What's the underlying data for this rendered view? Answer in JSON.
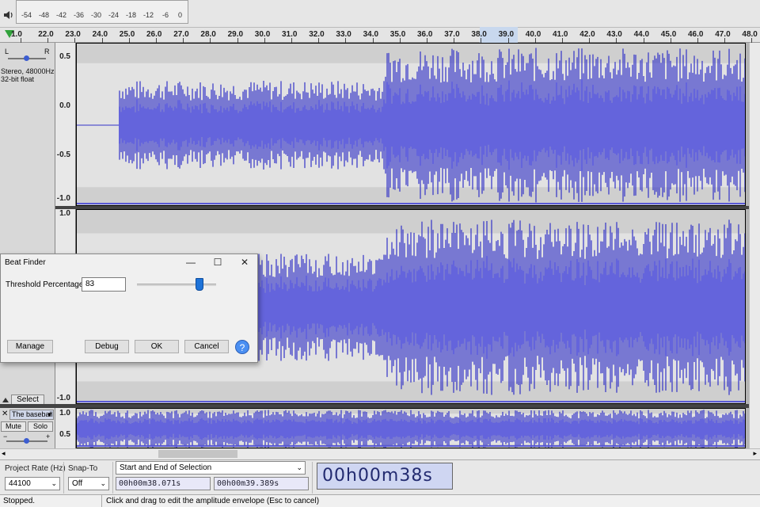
{
  "meter": {
    "ticks": [
      "-54",
      "-48",
      "-42",
      "-36",
      "-30",
      "-24",
      "-18",
      "-12",
      "-6",
      "0"
    ]
  },
  "ruler": {
    "labels": [
      "1.0",
      "22.0",
      "23.0",
      "24.0",
      "25.0",
      "26.0",
      "27.0",
      "28.0",
      "29.0",
      "30.0",
      "31.0",
      "32.0",
      "33.0",
      "34.0",
      "35.0",
      "36.0",
      "37.0",
      "38.0",
      "39.0",
      "40.0",
      "41.0",
      "42.0",
      "43.0",
      "44.0",
      "45.0",
      "46.0",
      "47.0",
      "48.0"
    ]
  },
  "track1": {
    "pan_left": "L",
    "pan_right": "R",
    "info_line1": "Stereo, 48000Hz",
    "info_line2": "32-bit float",
    "scale": [
      "0.5",
      "0.0",
      "-0.5",
      "-1.0"
    ],
    "scale_lower": [
      "1.0",
      "-1.0"
    ],
    "select_label": "Select"
  },
  "track2": {
    "name": "The baseball",
    "mute_label": "Mute",
    "solo_label": "Solo",
    "scale": [
      "1.0",
      "0.5"
    ]
  },
  "dialog": {
    "title": "Beat Finder",
    "threshold_label": "Threshold Percentage:",
    "threshold_value": "83",
    "manage_label": "Manage",
    "debug_label": "Debug",
    "ok_label": "OK",
    "cancel_label": "Cancel",
    "help_icon": "?",
    "slider_percent": 83
  },
  "bottom": {
    "project_rate_label": "Project Rate (Hz)",
    "project_rate_value": "44100",
    "snap_to_label": "Snap-To",
    "snap_to_value": "Off",
    "selection_mode": "Start and End of Selection",
    "sel_start": "00h00m38.071s",
    "sel_end": "00h00m39.389s",
    "audio_position": "00h00m38s"
  },
  "status": {
    "state": "Stopped.",
    "hint": "Click and drag to edit the amplitude envelope (Esc to cancel)"
  },
  "colors": {
    "wave_dark": "#3232c8",
    "wave_light": "#6464dc",
    "wave_bg": "#cfcfcf",
    "clip_bg": "#b4b4b4",
    "accent": "#1e73d8"
  }
}
